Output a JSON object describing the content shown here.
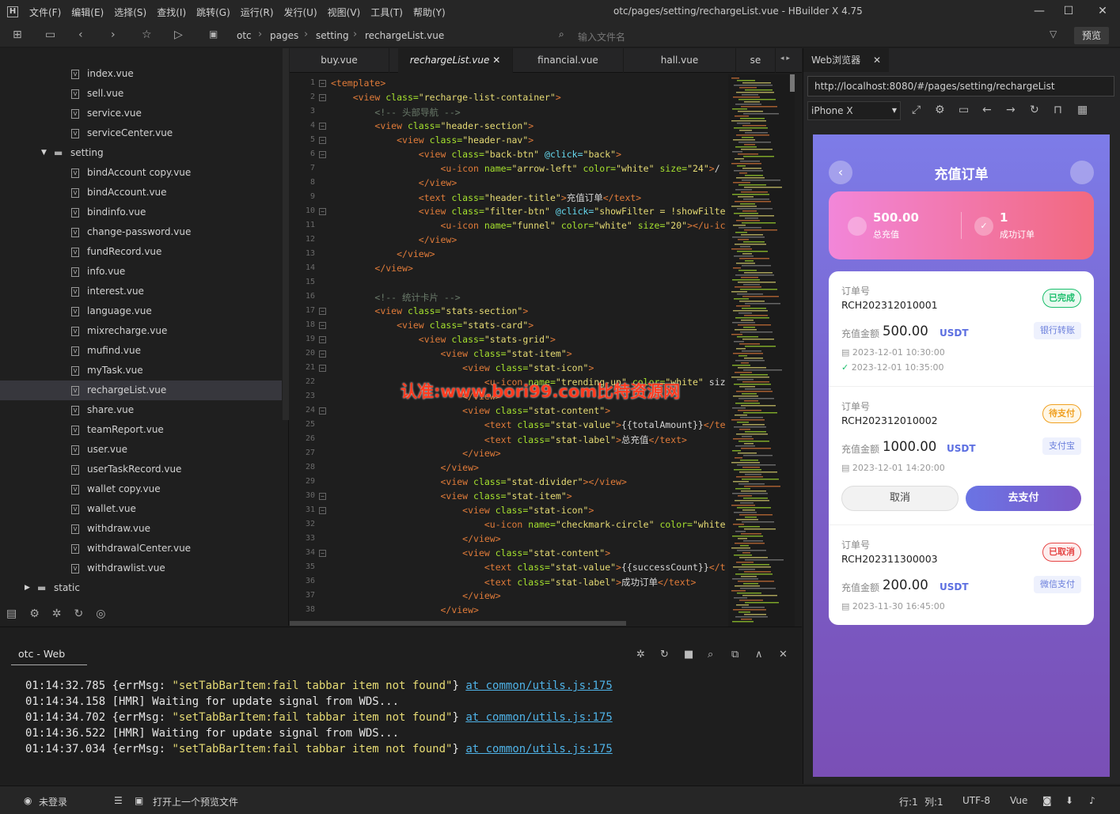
{
  "menu": [
    "文件(F)",
    "编辑(E)",
    "选择(S)",
    "查找(I)",
    "跳转(G)",
    "运行(R)",
    "发行(U)",
    "视图(V)",
    "工具(T)",
    "帮助(Y)"
  ],
  "window_title": "otc/pages/setting/rechargeList.vue - HBuilder X 4.75",
  "breadcrumb": [
    "otc",
    "pages",
    "setting",
    "rechargeList.vue"
  ],
  "search_placeholder": "输入文件名",
  "preview_label": "预览",
  "files": [
    "index.vue",
    "sell.vue",
    "service.vue",
    "serviceCenter.vue",
    "setting",
    "bindAccount copy.vue",
    "bindAccount.vue",
    "bindinfo.vue",
    "change-password.vue",
    "fundRecord.vue",
    "info.vue",
    "interest.vue",
    "language.vue",
    "mixrecharge.vue",
    "mufind.vue",
    "myTask.vue",
    "rechargeList.vue",
    "share.vue",
    "teamReport.vue",
    "user.vue",
    "userTaskRecord.vue",
    "wallet copy.vue",
    "wallet.vue",
    "withdraw.vue",
    "withdrawalCenter.vue",
    "withdrawlist.vue",
    "static"
  ],
  "tabs": [
    "buy.vue",
    "rechargeList.vue",
    "financial.vue",
    "hall.vue",
    "se"
  ],
  "code_lines": [
    [
      "1",
      "<template>"
    ],
    [
      "2",
      "    <view class=\"recharge-list-container\">"
    ],
    [
      "3",
      "        <!-- 头部导航 -->"
    ],
    [
      "4",
      "        <view class=\"header-section\">"
    ],
    [
      "5",
      "            <view class=\"header-nav\">"
    ],
    [
      "6",
      "                <view class=\"back-btn\" @click=\"back\">"
    ],
    [
      "7",
      "                    <u-icon name=\"arrow-left\" color=\"white\" size=\"24\"></"
    ],
    [
      "8",
      "                </view>"
    ],
    [
      "9",
      "                <text class=\"header-title\">充值订单</text>"
    ],
    [
      "10",
      "                <view class=\"filter-btn\" @click=\"showFilter = !showFilte"
    ],
    [
      "11",
      "                    <u-icon name=\"funnel\" color=\"white\" size=\"20\"></u-ic"
    ],
    [
      "12",
      "                </view>"
    ],
    [
      "13",
      "            </view>"
    ],
    [
      "14",
      "        </view>"
    ],
    [
      "15",
      ""
    ],
    [
      "16",
      "        <!-- 统计卡片 -->"
    ],
    [
      "17",
      "        <view class=\"stats-section\">"
    ],
    [
      "18",
      "            <view class=\"stats-card\">"
    ],
    [
      "19",
      "                <view class=\"stats-grid\">"
    ],
    [
      "20",
      "                    <view class=\"stat-item\">"
    ],
    [
      "21",
      "                        <view class=\"stat-icon\">"
    ],
    [
      "22",
      "                            <u-icon name=\"trending-up\" color=\"white\" siz"
    ],
    [
      "23",
      "                        </view>"
    ],
    [
      "24",
      "                        <view class=\"stat-content\">"
    ],
    [
      "25",
      "                            <text class=\"stat-value\">{{totalAmount}}</te"
    ],
    [
      "26",
      "                            <text class=\"stat-label\">总充值</text>"
    ],
    [
      "27",
      "                        </view>"
    ],
    [
      "28",
      "                    </view>"
    ],
    [
      "29",
      "                    <view class=\"stat-divider\"></view>"
    ],
    [
      "30",
      "                    <view class=\"stat-item\">"
    ],
    [
      "31",
      "                        <view class=\"stat-icon\">"
    ],
    [
      "32",
      "                            <u-icon name=\"checkmark-circle\" color=\"white"
    ],
    [
      "33",
      "                        </view>"
    ],
    [
      "34",
      "                        <view class=\"stat-content\">"
    ],
    [
      "35",
      "                            <text class=\"stat-value\">{{successCount}}</t"
    ],
    [
      "36",
      "                            <text class=\"stat-label\">成功订单</text>"
    ],
    [
      "37",
      "                        </view>"
    ],
    [
      "38",
      "                    </view>"
    ]
  ],
  "watermark": "认准:www.bori99.com比特资源网",
  "browser": {
    "tab": "Web浏览器",
    "url": "http://localhost:8080/#/pages/setting/rechargeList",
    "device": "iPhone X"
  },
  "app": {
    "title": "充值订单",
    "stats": [
      {
        "value": "500.00",
        "label": "总充值"
      },
      {
        "value": "1",
        "label": "成功订单"
      }
    ],
    "order_no_label": "订单号",
    "amount_label": "充值金额",
    "currency": "USDT",
    "orders": [
      {
        "no": "RCH202312010001",
        "status": "已完成",
        "amount": "500.00",
        "method": "银行转账",
        "created": "2023-12-01 10:30:00",
        "done": "2023-12-01 10:35:00"
      },
      {
        "no": "RCH202312010002",
        "status": "待支付",
        "amount": "1000.00",
        "method": "支付宝",
        "created": "2023-12-01 14:20:00",
        "cancel": "取消",
        "pay": "去支付"
      },
      {
        "no": "RCH202311300003",
        "status": "已取消",
        "amount": "200.00",
        "method": "微信支付",
        "created": "2023-11-30 16:45:00"
      }
    ],
    "status_colors": {
      "done": "#19be6b",
      "pending": "#f0a020",
      "cancelled": "#e64545"
    }
  },
  "console": {
    "tab": "otc - Web",
    "logs": [
      {
        "t": "01:14:32.785 ",
        "pre": "{errMsg: ",
        "str": "\"setTabBarItem:fail tabbar item not found\"",
        "post": "} ",
        "link": "at common/utils.js:175"
      },
      {
        "t": "01:14:34.158 ",
        "pre": "[HMR] Waiting for update signal from WDS...",
        "str": "",
        "post": "",
        "link": ""
      },
      {
        "t": "01:14:34.702 ",
        "pre": "{errMsg: ",
        "str": "\"setTabBarItem:fail tabbar item not found\"",
        "post": "} ",
        "link": "at common/utils.js:175"
      },
      {
        "t": "01:14:36.522 ",
        "pre": "[HMR] Waiting for update signal from WDS...",
        "str": "",
        "post": "",
        "link": ""
      },
      {
        "t": "01:14:37.034 ",
        "pre": "{errMsg: ",
        "str": "\"setTabBarItem:fail tabbar item not found\"",
        "post": "} ",
        "link": "at common/utils.js:175"
      }
    ]
  },
  "status": {
    "login": "未登录",
    "open_prev": "打开上一个预览文件",
    "pos_line": "行:1",
    "pos_col": "列:1",
    "encoding": "UTF-8",
    "lang": "Vue"
  }
}
